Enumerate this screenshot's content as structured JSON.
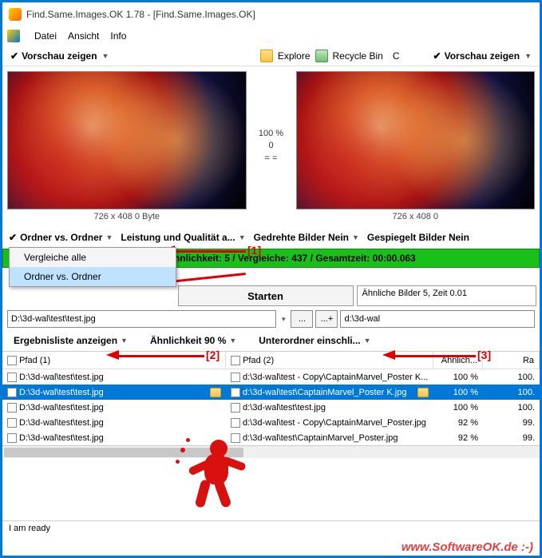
{
  "title": "Find.Same.Images.OK 1.78 - [Find.Same.Images.OK]",
  "menu": {
    "file": "Datei",
    "view": "Ansicht",
    "info": "Info"
  },
  "toolbar": {
    "preview_left": "Vorschau zeigen",
    "preview_right": "Vorschau zeigen",
    "explore": "Explore",
    "recycle": "Recycle Bin",
    "c": "C"
  },
  "mid": {
    "pct": "100 %",
    "zero": "0",
    "eq": "= ="
  },
  "pvmeta_left": "726 x 408 0 Byte",
  "pvmeta_right": "726 x 408 0",
  "opts": {
    "mode": "Ordner vs. Ordner",
    "perf": "Leistung und Qualität a...",
    "rotated": "Gedrehte Bilder Nein",
    "mirrored": "Gespiegelt Bilder Nein"
  },
  "popup": {
    "all": "Vergleiche alle",
    "ovo": "Ordner vs. Ordner"
  },
  "progress": "Ähnlichkeit: 5 / Vergleiche: 437 / Gesamtzeit: 00:00.063",
  "pathline": "D:\\3d-wal\\test\\test.jpg",
  "start": "Starten",
  "simresult": "Ähnliche Bilder 5, Zeit 0.01",
  "path_left": "D:\\3d-wal\\test\\test.jpg",
  "btn_browse": "...",
  "btn_add": "...+",
  "path_right": "d:\\3d-wal",
  "opts2": {
    "results": "Ergebnisliste anzeigen",
    "sim": "Ähnlichkeit 90 %",
    "sub": "Unterordner einschli..."
  },
  "thead": {
    "p1": "Pfad (1)",
    "p2": "Pfad (2)",
    "sim": "Ähnlich...",
    "ra": "Ra"
  },
  "rows": [
    {
      "p1": "D:\\3d-wal\\test\\test.jpg",
      "p2": "d:\\3d-wal\\test - Copy\\CaptainMarvel_Poster K...",
      "sim": "100 %",
      "ra": "100.",
      "sel": false
    },
    {
      "p1": "D:\\3d-wal\\test\\test.jpg",
      "p2": "d:\\3d-wal\\test\\CaptainMarvel_Poster K.jpg",
      "sim": "100 %",
      "ra": "100.",
      "sel": true
    },
    {
      "p1": "D:\\3d-wal\\test\\test.jpg",
      "p2": "d:\\3d-wal\\test\\test.jpg",
      "sim": "100 %",
      "ra": "100.",
      "sel": false
    },
    {
      "p1": "D:\\3d-wal\\test\\test.jpg",
      "p2": "d:\\3d-wal\\test - Copy\\CaptainMarvel_Poster.jpg",
      "sim": "92 %",
      "ra": "99.",
      "sel": false
    },
    {
      "p1": "D:\\3d-wal\\test\\test.jpg",
      "p2": "d:\\3d-wal\\test\\CaptainMarvel_Poster.jpg",
      "sim": "92 %",
      "ra": "99.",
      "sel": false
    }
  ],
  "status": "I am ready",
  "watermark": "www.SoftwareOK.de :-)",
  "ann": {
    "a1": "[1]",
    "a2": "[2]",
    "a3": "[3]"
  }
}
